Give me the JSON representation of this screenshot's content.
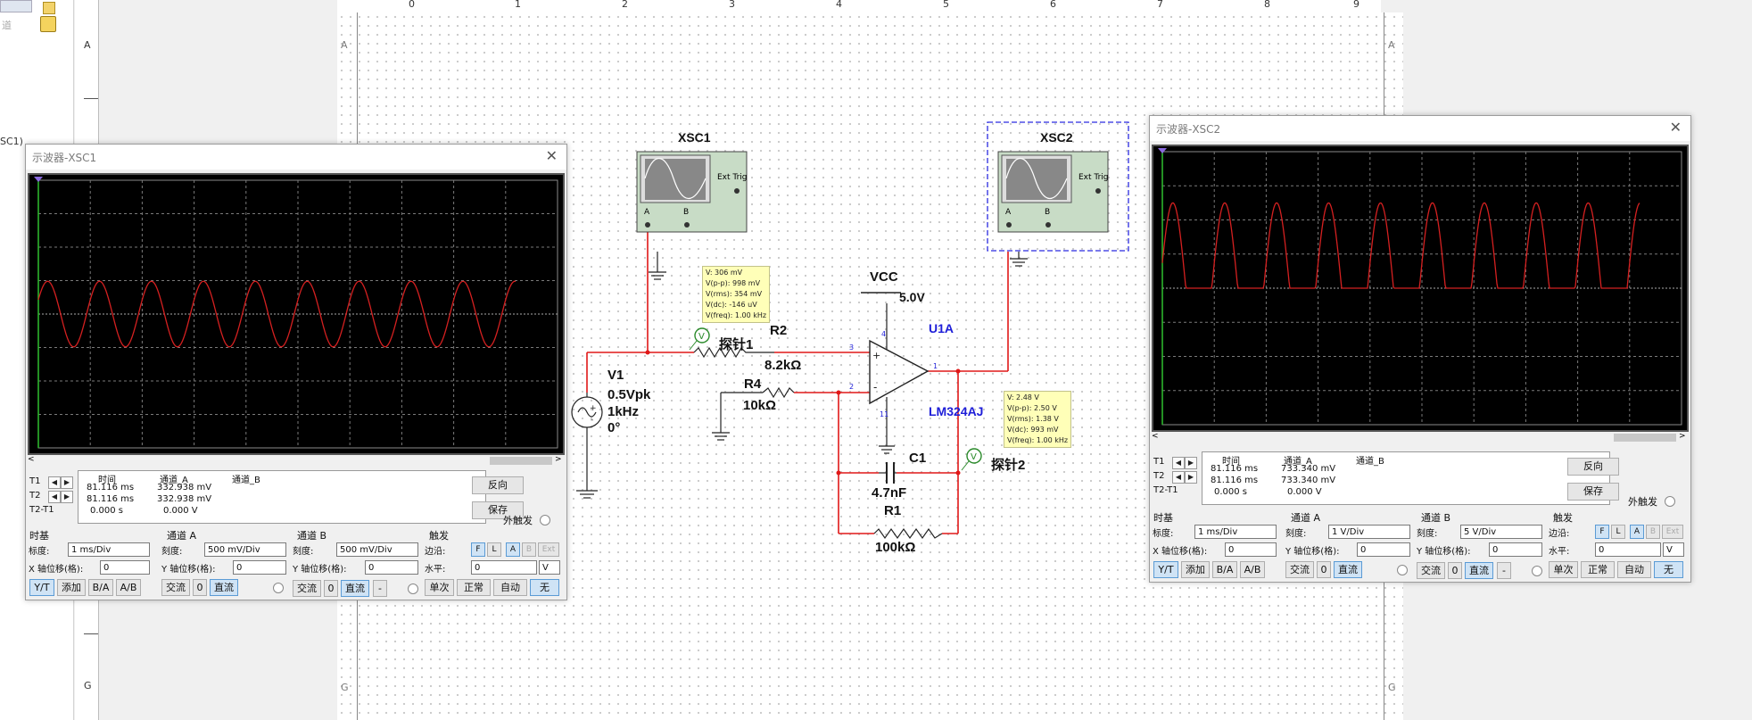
{
  "rulers": {
    "top": [
      "0",
      "1",
      "2",
      "3",
      "4",
      "5",
      "6",
      "7",
      "8",
      "9"
    ],
    "left": [
      "A",
      "G"
    ],
    "sheet_left": [
      "A",
      "G"
    ],
    "sheet_right": [
      "A",
      "G"
    ]
  },
  "left_panel": {
    "item1": "道",
    "item2": "SC1)"
  },
  "circuit": {
    "xsc1": "XSC1",
    "xsc2": "XSC2",
    "ext_trig": "Ext Trig",
    "ch_a": "A",
    "ch_b": "B",
    "vcc_label": "VCC",
    "vcc_value": "5.0V",
    "v1_name": "V1",
    "v1_amp": "0.5Vpk",
    "v1_freq": "1kHz",
    "v1_phase": "0°",
    "r2_name": "R2",
    "r2_value": "8.2kΩ",
    "r4_name": "R4",
    "r4_value": "10kΩ",
    "c1_name": "C1",
    "c1_value": "4.7nF",
    "r1_name": "R1",
    "r1_value": "100kΩ",
    "u1_name": "U1A",
    "u1_part": "LM324AJ",
    "probe1": "探针1",
    "probe2": "探针2",
    "pin3": "3",
    "pin2": "2",
    "pin1": "1",
    "pin4": "4",
    "pin11": "11",
    "probe1_tip": [
      "V: 306 mV",
      "V(p-p): 998 mV",
      "V(rms): 354 mV",
      "V(dc): -146 uV",
      "V(freq): 1.00 kHz"
    ],
    "probe2_tip": [
      "V: 2.48 V",
      "V(p-p): 2.50 V",
      "V(rms): 1.38 V",
      "V(dc): 993 mV",
      "V(freq): 1.00 kHz"
    ]
  },
  "scope1": {
    "title": "示波器-XSC1",
    "headers": [
      "时间",
      "通道_A",
      "通道_B"
    ],
    "rows": [
      {
        "label": "T1",
        "time": "81.116 ms",
        "a": "332.938 mV",
        "b": ""
      },
      {
        "label": "T2",
        "time": "81.116 ms",
        "a": "332.938 mV",
        "b": ""
      },
      {
        "label": "T2-T1",
        "time": "0.000 s",
        "a": "0.000 V",
        "b": ""
      }
    ],
    "reverse": "反向",
    "save": "保存",
    "ext_trigger": "外触发",
    "timebase": {
      "title": "时基",
      "scale_label": "标度:",
      "scale": "1 ms/Div",
      "xpos_label": "X 轴位移(格):",
      "xpos": "0",
      "btns": [
        "Y/T",
        "添加",
        "B/A",
        "A/B"
      ]
    },
    "cha": {
      "title": "通道 A",
      "scale_label": "刻度:",
      "scale": "500 mV/Div",
      "ypos_label": "Y 轴位移(格):",
      "ypos": "0",
      "btns": [
        "交流",
        "0",
        "直流"
      ]
    },
    "chb": {
      "title": "通道 B",
      "scale_label": "刻度:",
      "scale": "500 mV/Div",
      "ypos_label": "Y 轴位移(格):",
      "ypos": "0",
      "btns": [
        "交流",
        "0",
        "直流",
        "-"
      ]
    },
    "trig": {
      "title": "触发",
      "edge_label": "边沿:",
      "level_label": "水平:",
      "level": "0",
      "unit": "V",
      "edge_btns": [
        "F",
        "L",
        "A",
        "B",
        "Ext"
      ],
      "btns": [
        "单次",
        "正常",
        "自动",
        "无"
      ]
    }
  },
  "scope2": {
    "title": "示波器-XSC2",
    "headers": [
      "时间",
      "通道_A",
      "通道_B"
    ],
    "rows": [
      {
        "label": "T1",
        "time": "81.116 ms",
        "a": "733.340 mV",
        "b": ""
      },
      {
        "label": "T2",
        "time": "81.116 ms",
        "a": "733.340 mV",
        "b": ""
      },
      {
        "label": "T2-T1",
        "time": "0.000 s",
        "a": "0.000 V",
        "b": ""
      }
    ],
    "reverse": "反向",
    "save": "保存",
    "ext_trigger": "外触发",
    "timebase": {
      "title": "时基",
      "scale_label": "标度:",
      "scale": "1 ms/Div",
      "xpos_label": "X 轴位移(格):",
      "xpos": "0",
      "btns": [
        "Y/T",
        "添加",
        "B/A",
        "A/B"
      ]
    },
    "cha": {
      "title": "通道 A",
      "scale_label": "刻度:",
      "scale": "1 V/Div",
      "ypos_label": "Y 轴位移(格):",
      "ypos": "0",
      "btns": [
        "交流",
        "0",
        "直流"
      ]
    },
    "chb": {
      "title": "通道 B",
      "scale_label": "刻度:",
      "scale": "5 V/Div",
      "ypos_label": "Y 轴位移(格):",
      "ypos": "0",
      "btns": [
        "交流",
        "0",
        "直流",
        "-"
      ]
    },
    "trig": {
      "title": "触发",
      "edge_label": "边沿:",
      "level_label": "水平:",
      "level": "0",
      "unit": "V",
      "edge_btns": [
        "F",
        "L",
        "A",
        "B",
        "Ext"
      ],
      "btns": [
        "单次",
        "正常",
        "自动",
        "无"
      ]
    }
  },
  "colors": {
    "trace": "#d42020",
    "wire": "#e01818",
    "grid": "#9a9a9a",
    "screen": "#000000"
  }
}
